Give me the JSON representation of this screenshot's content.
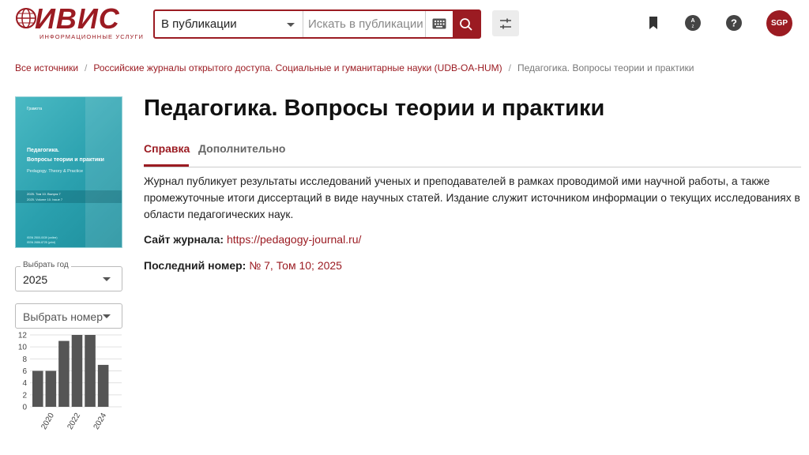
{
  "header": {
    "logo": {
      "name": "ИВИС",
      "subtitle": "ИНФОРМАЦИОННЫЕ УСЛУГИ"
    },
    "search": {
      "scope": "В публикации",
      "placeholder": "Искать в публикации",
      "keyboard_icon": "keyboard-icon",
      "search_icon": "search-icon"
    },
    "filter_icon": "tune-icon",
    "icons": [
      "bookmark-icon",
      "translate-icon",
      "help-icon"
    ],
    "avatar": "SGP",
    "accent": "#9b1b22"
  },
  "breadcrumb": {
    "items": [
      "Все источники",
      "Российские журналы открытого доступа. Социальные и гуманитарные науки (UDB-OA-HUM)"
    ],
    "current": "Педагогика. Вопросы теории и практики",
    "separator": "/"
  },
  "cover": {
    "publisher": "Грамота",
    "title_line1": "Педагогика.",
    "title_line2": "Вопросы теории и практики",
    "title_en": "Pedagogy. Theory & Practice",
    "issue_line1": "2025. Том 10. Выпуск 7",
    "issue_line2": "2025. Volume 10. Issue 7",
    "issn_line1": "ISSN 2500-0039 (online)",
    "issn_line2": "ISSN 2686-8725 (print)"
  },
  "sidebar": {
    "year_select": {
      "label": "Выбрать год",
      "value": "2025"
    },
    "issue_select": {
      "placeholder": "Выбрать номер"
    }
  },
  "chart_data": {
    "type": "bar",
    "x": [
      2019,
      2020,
      2021,
      2022,
      2023,
      2024,
      2025
    ],
    "values": [
      6,
      6,
      11,
      12,
      12,
      7,
      0
    ],
    "tick_labels_x": [
      "2020",
      "2022",
      "2024"
    ],
    "tick_values_x": [
      2020,
      2022,
      2024
    ],
    "ylim": [
      0,
      12
    ],
    "yticks": [
      0,
      2,
      4,
      6,
      8,
      10,
      12
    ],
    "grid": true,
    "bar_color": "#555555"
  },
  "main": {
    "title": "Педагогика. Вопросы теории и практики",
    "tabs": [
      {
        "label": "Справка",
        "active": true
      },
      {
        "label": "Дополнительно",
        "active": false
      }
    ],
    "description": "Журнал публикует результаты исследований ученых и преподавателей в рамках проводимой ими научной работы, а также промежуточные итоги диссертаций в виде научных статей. Издание служит источником информации о текущих исследованиях в области педагогических наук.",
    "site_label": "Сайт журнала:",
    "site_url": "https://pedagogy-journal.ru/",
    "last_issue_label": "Последний номер:",
    "last_issue_value": "№ 7, Том 10; 2025"
  }
}
